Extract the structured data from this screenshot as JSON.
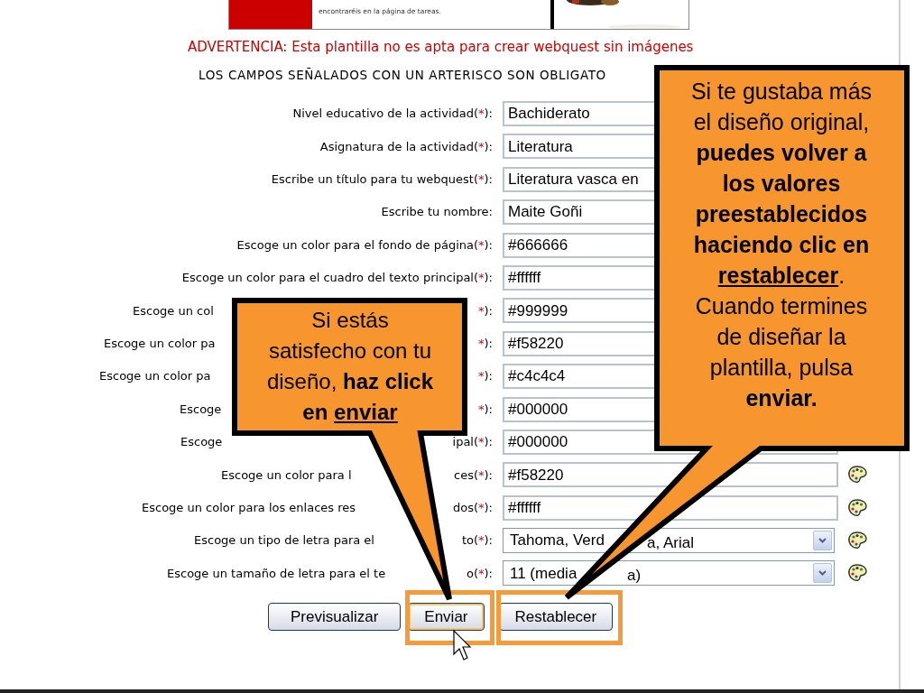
{
  "banner": {
    "caption": "encontraréis en la página de tareas.",
    "kind": "picture"
  },
  "warning": "ADVERTENCIA: Esta plantilla no es apta para crear webquest sin imágenes",
  "required_note": "LOS CAMPOS SEÑALADOS CON UN ARTERISCO SON OBLIGATO",
  "fields": [
    {
      "label": "Nivel educativo de la actividad(",
      "asterisk": "*",
      "suffix": "):",
      "kind": "text",
      "value": "Bachiderato",
      "color_picker": false
    },
    {
      "label": "Asignatura de la actividad(",
      "asterisk": "*",
      "suffix": "):",
      "kind": "text",
      "value": "Literatura",
      "color_picker": false
    },
    {
      "label": "Escribe un título para tu webquest(",
      "asterisk": "*",
      "suffix": "):",
      "kind": "text",
      "value": "Literatura vasca en",
      "color_picker": false
    },
    {
      "label": "Escribe tu nombre:",
      "kind": "text",
      "value": "Maite Goñi",
      "color_picker": false
    },
    {
      "label": "Escoge un color para el fondo de página(",
      "asterisk": "*",
      "suffix": "):",
      "kind": "text",
      "value": "#666666",
      "color_picker": false
    },
    {
      "label": "Escoge un color para el cuadro del texto principal(",
      "asterisk": "*",
      "suffix": "):",
      "kind": "text",
      "value": "#ffffff",
      "color_picker": false
    },
    {
      "label": "Escoge un col",
      "asterisk": "*",
      "suffix": "):",
      "kind": "text",
      "value": "#999999",
      "color_picker": false
    },
    {
      "label": "Escoge un color pa",
      "asterisk": "*",
      "suffix": "):",
      "kind": "text",
      "value": "#f58220",
      "color_picker": false
    },
    {
      "label": "Escoge un color pa",
      "asterisk": "*",
      "suffix": "):",
      "kind": "text",
      "value": "#c4c4c4",
      "color_picker": false
    },
    {
      "label": "Escoge",
      "asterisk": "*",
      "suffix": "):",
      "kind": "text",
      "value": "#000000",
      "color_picker": false
    },
    {
      "label": "Escoge",
      "label_tail": "ipal(",
      "asterisk": "*",
      "suffix": "):",
      "kind": "text",
      "value": "#000000",
      "color_picker": false
    },
    {
      "label": "Escoge un color para l",
      "label_tail": "ces(",
      "asterisk": "*",
      "suffix": "):",
      "kind": "text",
      "value": "#f58220",
      "color_picker": true
    },
    {
      "label": "Escoge un color para los enlaces res",
      "label_tail": "dos(",
      "asterisk": "*",
      "suffix": "):",
      "kind": "text",
      "value": "#ffffff",
      "color_picker": true
    },
    {
      "label": "Escoge un tipo de letra para el",
      "label_tail": "to(",
      "asterisk": "*",
      "suffix": "):",
      "kind": "select",
      "value": "Tahoma, Verd",
      "value_tail": "a, Arial",
      "color_picker": true
    },
    {
      "label": "Escoge un tamaño de letra para el te",
      "label_tail": "o(",
      "asterisk": "*",
      "suffix": "):",
      "kind": "select",
      "value": "11 (media",
      "value_tail": "a)",
      "color_picker": true
    }
  ],
  "buttons": [
    {
      "label": "Previsualizar",
      "highlighted": false,
      "focused": false
    },
    {
      "label": "Enviar",
      "highlighted": true,
      "focused": true
    },
    {
      "label": "Restablecer",
      "highlighted": true,
      "focused": false
    }
  ],
  "callouts": [
    {
      "segments": [
        {
          "text": "Si estás satisfecho con tu diseño, ",
          "bold": false,
          "underline": false
        },
        {
          "text": "haz click en ",
          "bold": true,
          "underline": false
        },
        {
          "text": "enviar",
          "bold": true,
          "underline": true
        }
      ]
    },
    {
      "segments": [
        {
          "text": "Si te gustaba más el diseño original, ",
          "bold": false,
          "underline": false
        },
        {
          "text": "puedes volver a los valores preestablecidos haciendo clic en ",
          "bold": true,
          "underline": false
        },
        {
          "text": "restablecer",
          "bold": true,
          "underline": true
        },
        {
          "text": ". Cuando termines de diseñar la plantilla, pulsa ",
          "bold": false,
          "underline": false
        },
        {
          "text": "enviar.",
          "bold": true,
          "underline": false
        }
      ]
    }
  ]
}
